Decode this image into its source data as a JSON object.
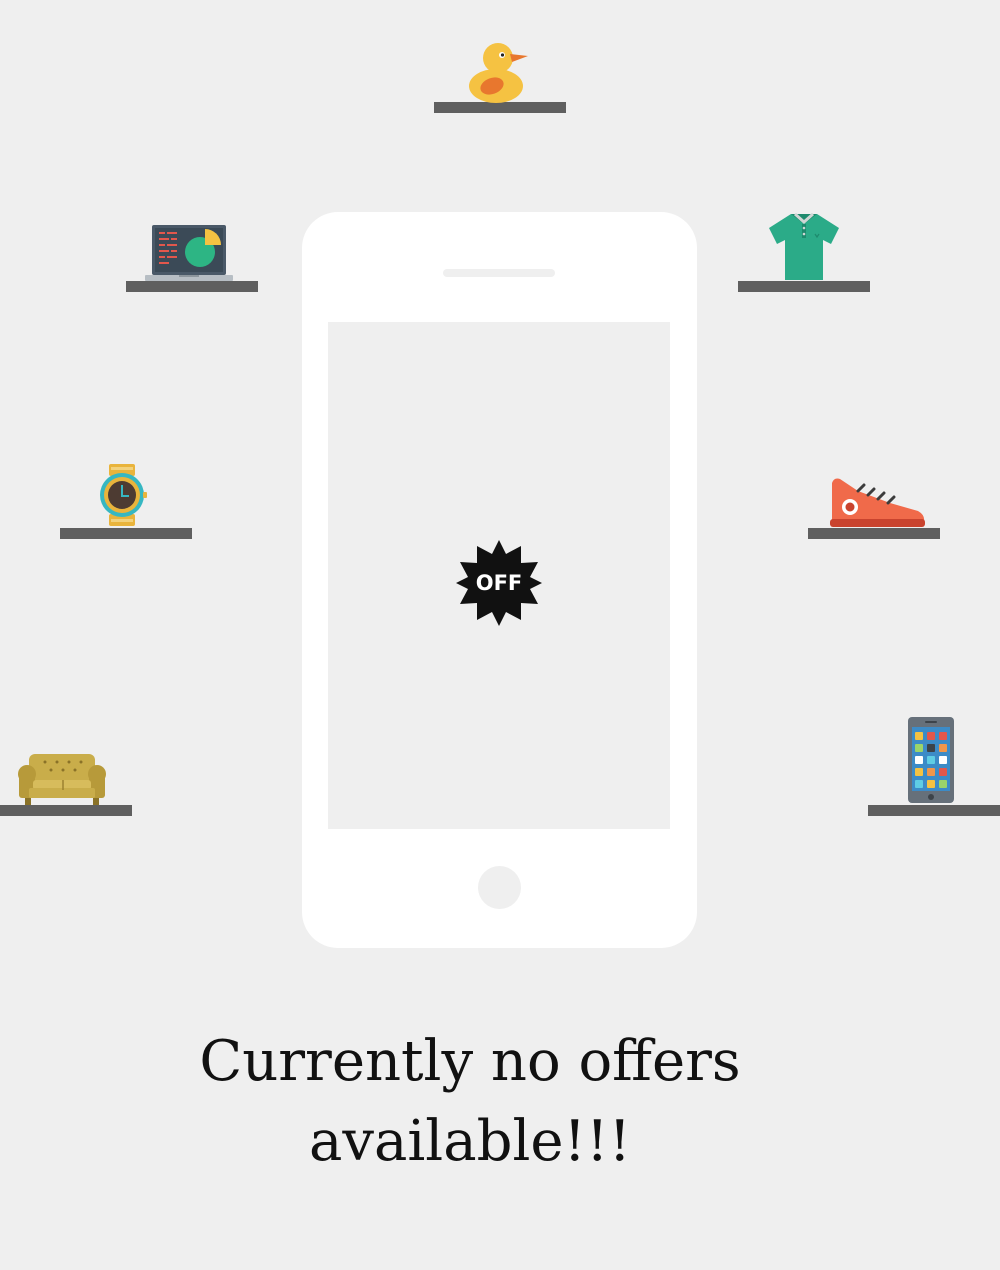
{
  "empty_state": {
    "badge_label": "OFF",
    "message_line1": "Currently no offers",
    "message_line2": "available!!!"
  },
  "icons": [
    "rubber-duck-icon",
    "laptop-icon",
    "polo-shirt-icon",
    "wristwatch-icon",
    "sneaker-icon",
    "sofa-icon",
    "smartphone-icon",
    "offer-badge-icon"
  ],
  "colors": {
    "background": "#efefef",
    "shelf": "#5f5f5f",
    "phone_body": "#ffffff",
    "badge": "#111111"
  }
}
